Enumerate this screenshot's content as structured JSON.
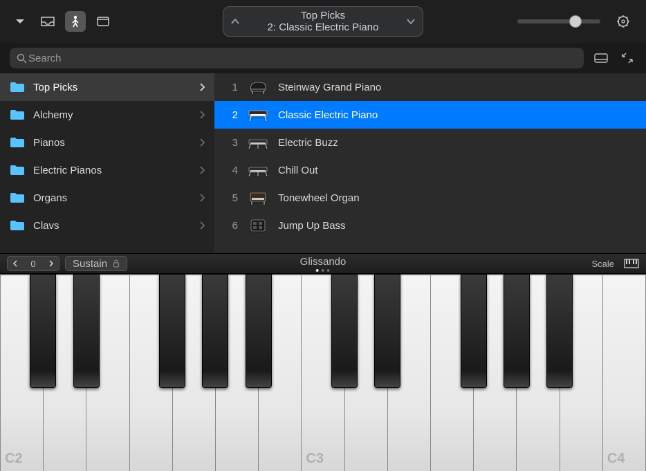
{
  "toolbar": {
    "view_buttons": [
      {
        "id": "view-tracks",
        "active": false
      },
      {
        "id": "view-browser",
        "active": false
      },
      {
        "id": "view-keyboard",
        "active": true
      },
      {
        "id": "view-window",
        "active": false
      }
    ],
    "preset_title_line1": "Top Picks",
    "preset_title_line2": "2: Classic Electric Piano",
    "volume_percent": 70
  },
  "search": {
    "placeholder": "Search",
    "value": ""
  },
  "categories": [
    {
      "label": "Top Picks",
      "selected": true
    },
    {
      "label": "Alchemy",
      "selected": false
    },
    {
      "label": "Pianos",
      "selected": false
    },
    {
      "label": "Electric Pianos",
      "selected": false
    },
    {
      "label": "Organs",
      "selected": false
    },
    {
      "label": "Clavs",
      "selected": false
    }
  ],
  "presets": [
    {
      "num": "1",
      "label": "Steinway Grand Piano",
      "selected": false,
      "icon": "grand-piano"
    },
    {
      "num": "2",
      "label": "Classic Electric Piano",
      "selected": true,
      "icon": "electric-piano"
    },
    {
      "num": "3",
      "label": "Electric Buzz",
      "selected": false,
      "icon": "synth"
    },
    {
      "num": "4",
      "label": "Chill Out",
      "selected": false,
      "icon": "synth"
    },
    {
      "num": "5",
      "label": "Tonewheel Organ",
      "selected": false,
      "icon": "organ"
    },
    {
      "num": "6",
      "label": "Jump Up Bass",
      "selected": false,
      "icon": "pad"
    }
  ],
  "kb_strip": {
    "octave_value": "0",
    "sustain_label": "Sustain",
    "mode_label": "Glissando",
    "scale_label": "Scale"
  },
  "keyboard": {
    "octave_labels": [
      "C2",
      "C3",
      "C4"
    ]
  }
}
